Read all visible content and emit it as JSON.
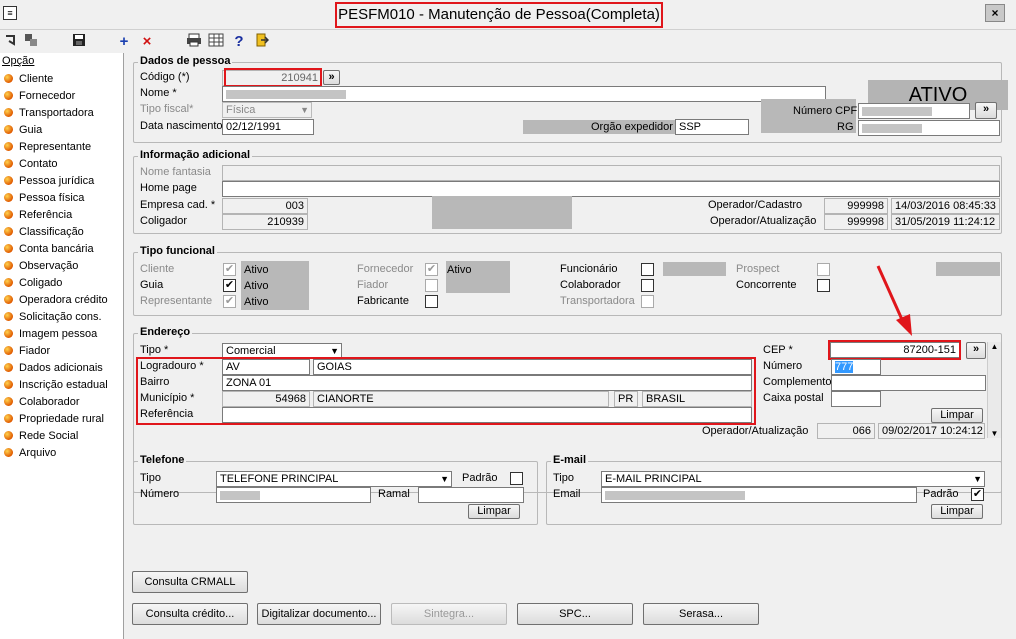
{
  "window": {
    "title": "PESFM010 - Manutenção de Pessoa(Completa)",
    "close": "×",
    "sys": "≡"
  },
  "toolbar": {
    "icons": [
      "enter-icon",
      "grid-icon",
      "save-icon",
      "add-icon",
      "delete-icon",
      "print-icon",
      "table-icon",
      "help-icon",
      "exit-icon"
    ],
    "add": "+",
    "delete": "×",
    "help": "?"
  },
  "sidebar": {
    "header": "Opção",
    "items": [
      "Cliente",
      "Fornecedor",
      "Transportadora",
      "Guia",
      "Representante",
      "Contato",
      "Pessoa jurídica",
      "Pessoa física",
      "Referência",
      "Classificação",
      "Conta bancária",
      "Observação",
      "Coligado",
      "Operadora crédito",
      "Solicitação cons.",
      "Imagem pessoa",
      "Fiador",
      "Dados adicionais",
      "Inscrição estadual",
      "Colaborador",
      "Propriedade rural",
      "Rede Social",
      "Arquivo"
    ]
  },
  "dados": {
    "title": "Dados de pessoa",
    "codigo_label": "Código (*)",
    "codigo": "210941",
    "nome_label": "Nome *",
    "tipo_fiscal_label": "Tipo fiscal*",
    "tipo_fiscal": "Física",
    "nasc_label": "Data nascimento",
    "nasc": "02/12/1991",
    "orgao_label": "Orgão expedidor",
    "orgao": "SSP",
    "cpf_label": "Número CPF",
    "rg_label": "RG",
    "status": "ATIVO",
    "more": "»"
  },
  "info": {
    "title": "Informação adicional",
    "fantasia_label": "Nome fantasia",
    "homepage_label": "Home page",
    "empresa_label": "Empresa cad. *",
    "empresa": "003",
    "coligador_label": "Coligador",
    "coligador": "210939",
    "op_cad_label": "Operador/Cadastro",
    "op_cad": "999998",
    "op_cad_dt": "14/03/2016 08:45:33",
    "op_atu_label": "Operador/Atualização",
    "op_atu": "999998",
    "op_atu_dt": "31/05/2019 11:24:12"
  },
  "tipo": {
    "title": "Tipo funcional",
    "cliente": "Cliente",
    "guia": "Guia",
    "representante": "Representante",
    "ativo": "Ativo",
    "fornecedor": "Fornecedor",
    "fiador": "Fiador",
    "fabricante": "Fabricante",
    "funcionario": "Funcionário",
    "colaborador": "Colaborador",
    "transportadora": "Transportadora",
    "prospect": "Prospect",
    "concorrente": "Concorrente",
    "check": "✔"
  },
  "endereco": {
    "title": "Endereço",
    "tipo_label": "Tipo *",
    "tipo": "Comercial",
    "logradouro_label": "Logradouro *",
    "logradouro_tipo": "AV",
    "logradouro": "GOIAS",
    "bairro_label": "Bairro",
    "bairro": "ZONA 01",
    "municipio_label": "Município *",
    "municipio_cod": "54968",
    "municipio": "CIANORTE",
    "uf": "PR",
    "pais": "BRASIL",
    "referencia_label": "Referência",
    "cep_label": "CEP *",
    "cep": "87200-151",
    "numero_label": "Número",
    "numero": "777",
    "complemento_label": "Complemento",
    "caixa_label": "Caixa postal",
    "limpar": "Limpar",
    "op_atu_label": "Operador/Atualização",
    "op_atu": "066",
    "op_atu_dt": "09/02/2017 10:24:12"
  },
  "telefone": {
    "title": "Telefone",
    "tipo_label": "Tipo",
    "tipo": "TELEFONE PRINCIPAL",
    "padrao_label": "Padrão",
    "numero_label": "Número",
    "ramal_label": "Ramal",
    "limpar": "Limpar"
  },
  "email": {
    "title": "E-mail",
    "tipo_label": "Tipo",
    "tipo": "E-MAIL PRINCIPAL",
    "email_label": "Email",
    "padrao_label": "Padrão",
    "limpar": "Limpar"
  },
  "buttons": {
    "crmall": "Consulta CRMALL",
    "credito": "Consulta crédito...",
    "digitalizar": "Digitalizar documento...",
    "sintegra": "Sintegra...",
    "spc": "SPC...",
    "serasa": "Serasa..."
  }
}
